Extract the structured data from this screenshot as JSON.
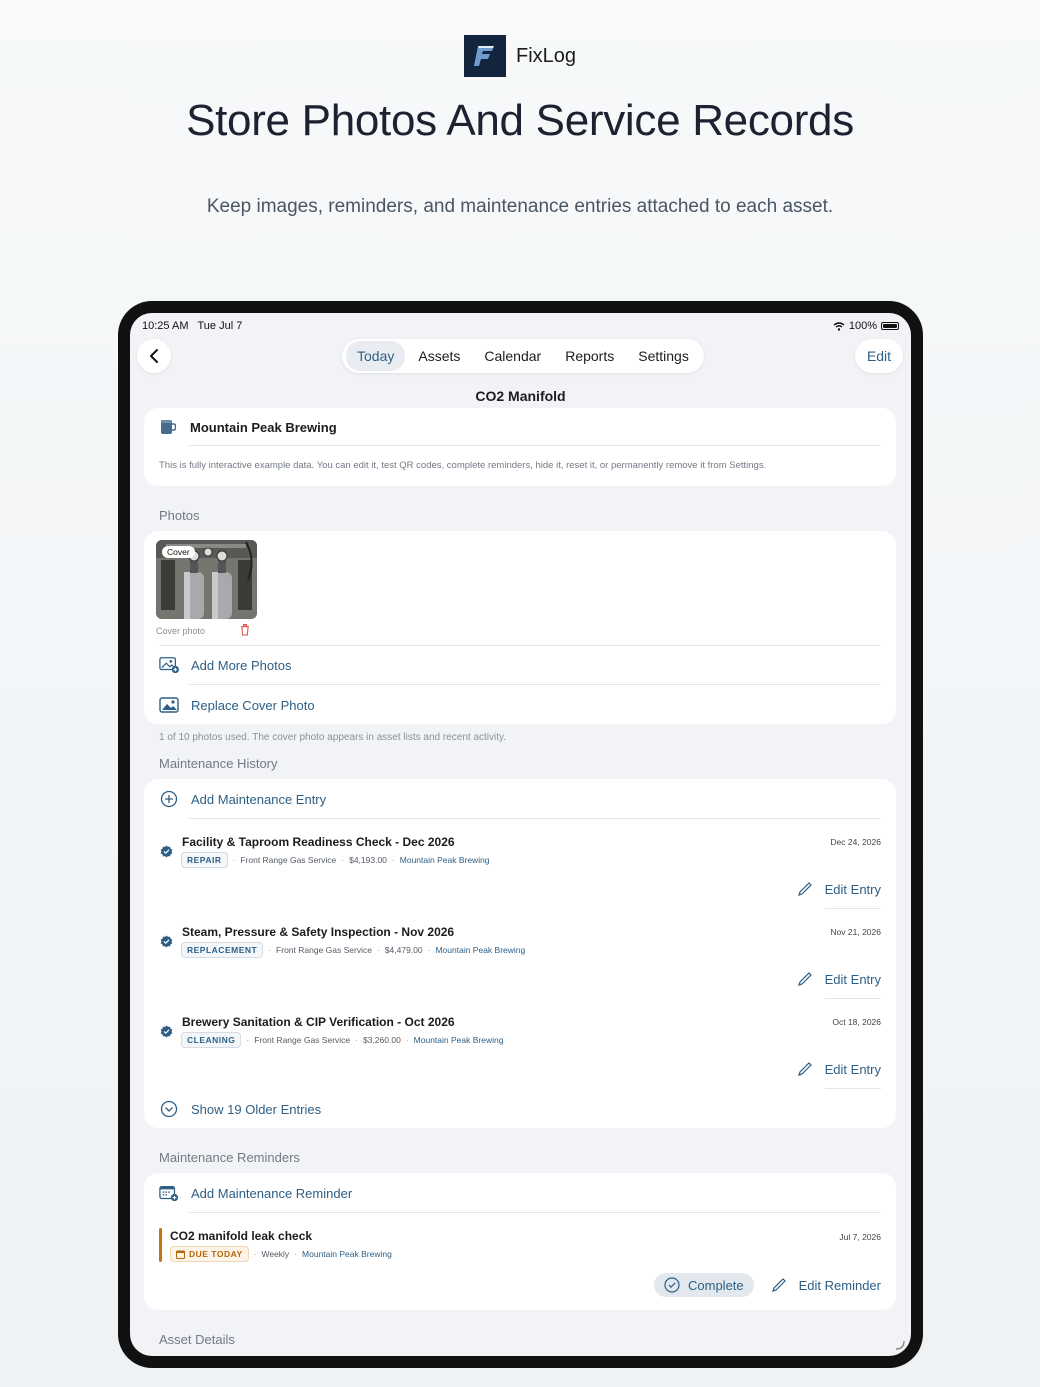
{
  "brand": {
    "name": "FixLog"
  },
  "headline": "Store Photos And Service Records",
  "subline": "Keep images, reminders, and maintenance entries attached to each asset.",
  "status_bar": {
    "time": "10:25 AM",
    "date": "Tue Jul 7",
    "battery": "100%",
    "battery_level": 1.0
  },
  "nav": {
    "tabs": [
      {
        "label": "Today",
        "active": true
      },
      {
        "label": "Assets",
        "active": false
      },
      {
        "label": "Calendar",
        "active": false
      },
      {
        "label": "Reports",
        "active": false
      },
      {
        "label": "Settings",
        "active": false
      }
    ],
    "edit_label": "Edit"
  },
  "page_title": "CO2 Manifold",
  "business": {
    "name": "Mountain Peak Brewing",
    "note": "This is fully interactive example data. You can edit it, test QR codes, complete reminders, hide it, reset it, or permanently remove it from Settings."
  },
  "photos": {
    "section_label": "Photos",
    "cover_chip": "Cover",
    "cover_caption": "Cover photo",
    "add_more_label": "Add More Photos",
    "replace_label": "Replace Cover Photo",
    "footnote": "1 of 10 photos used. The cover photo appears in asset lists and recent activity."
  },
  "maintenance": {
    "section_label": "Maintenance History",
    "add_label": "Add Maintenance Entry",
    "entries": [
      {
        "title": "Facility & Taproom Readiness Check - Dec 2026",
        "tag": "REPAIR",
        "vendor": "Front Range Gas Service",
        "cost": "$4,193.00",
        "location": "Mountain Peak Brewing",
        "date": "Dec 24, 2026",
        "edit_label": "Edit Entry"
      },
      {
        "title": "Steam, Pressure & Safety Inspection - Nov 2026",
        "tag": "REPLACEMENT",
        "vendor": "Front Range Gas Service",
        "cost": "$4,479.00",
        "location": "Mountain Peak Brewing",
        "date": "Nov 21, 2026",
        "edit_label": "Edit Entry"
      },
      {
        "title": "Brewery Sanitation & CIP Verification - Oct 2026",
        "tag": "CLEANING",
        "vendor": "Front Range Gas Service",
        "cost": "$3,260.00",
        "location": "Mountain Peak Brewing",
        "date": "Oct 18, 2026",
        "edit_label": "Edit Entry"
      }
    ],
    "show_older_label": "Show 19 Older Entries"
  },
  "reminders": {
    "section_label": "Maintenance Reminders",
    "add_label": "Add Maintenance Reminder",
    "items": [
      {
        "title": "CO2 manifold leak check",
        "status": "DUE TODAY",
        "frequency": "Weekly",
        "location": "Mountain Peak Brewing",
        "date": "Jul 7, 2026",
        "complete_label": "Complete",
        "edit_label": "Edit Reminder"
      }
    ]
  },
  "asset_details": {
    "section_label": "Asset Details"
  },
  "colors": {
    "accent": "#2d5f86",
    "due": "#c27414",
    "brand_bg": "#13253c"
  }
}
